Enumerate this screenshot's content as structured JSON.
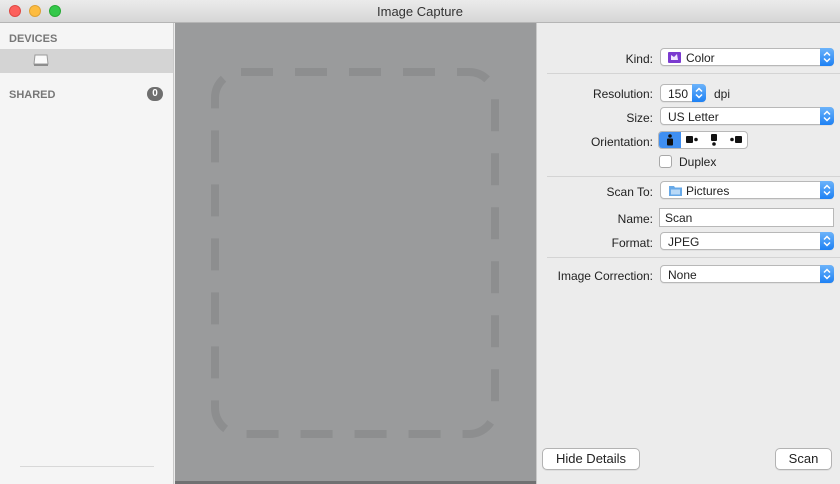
{
  "window": {
    "title": "Image Capture"
  },
  "sidebar": {
    "devices_header": "DEVICES",
    "shared_header": "SHARED",
    "shared_count": "0"
  },
  "settings": {
    "kind": {
      "label": "Kind:",
      "value": "Color"
    },
    "resolution": {
      "label": "Resolution:",
      "value": "150",
      "unit": "dpi"
    },
    "size": {
      "label": "Size:",
      "value": "US Letter"
    },
    "orientation": {
      "label": "Orientation:",
      "selected_index": 0
    },
    "duplex": {
      "label": "Duplex",
      "checked": false
    },
    "scan_to": {
      "label": "Scan To:",
      "value": "Pictures"
    },
    "name": {
      "label": "Name:",
      "value": "Scan"
    },
    "format": {
      "label": "Format:",
      "value": "JPEG"
    },
    "image_correction": {
      "label": "Image Correction:",
      "value": "None"
    }
  },
  "buttons": {
    "hide_details": "Hide Details",
    "scan": "Scan"
  },
  "colors": {
    "accent": "#3f8ff2",
    "preview_bg": "#9a9b9c"
  }
}
